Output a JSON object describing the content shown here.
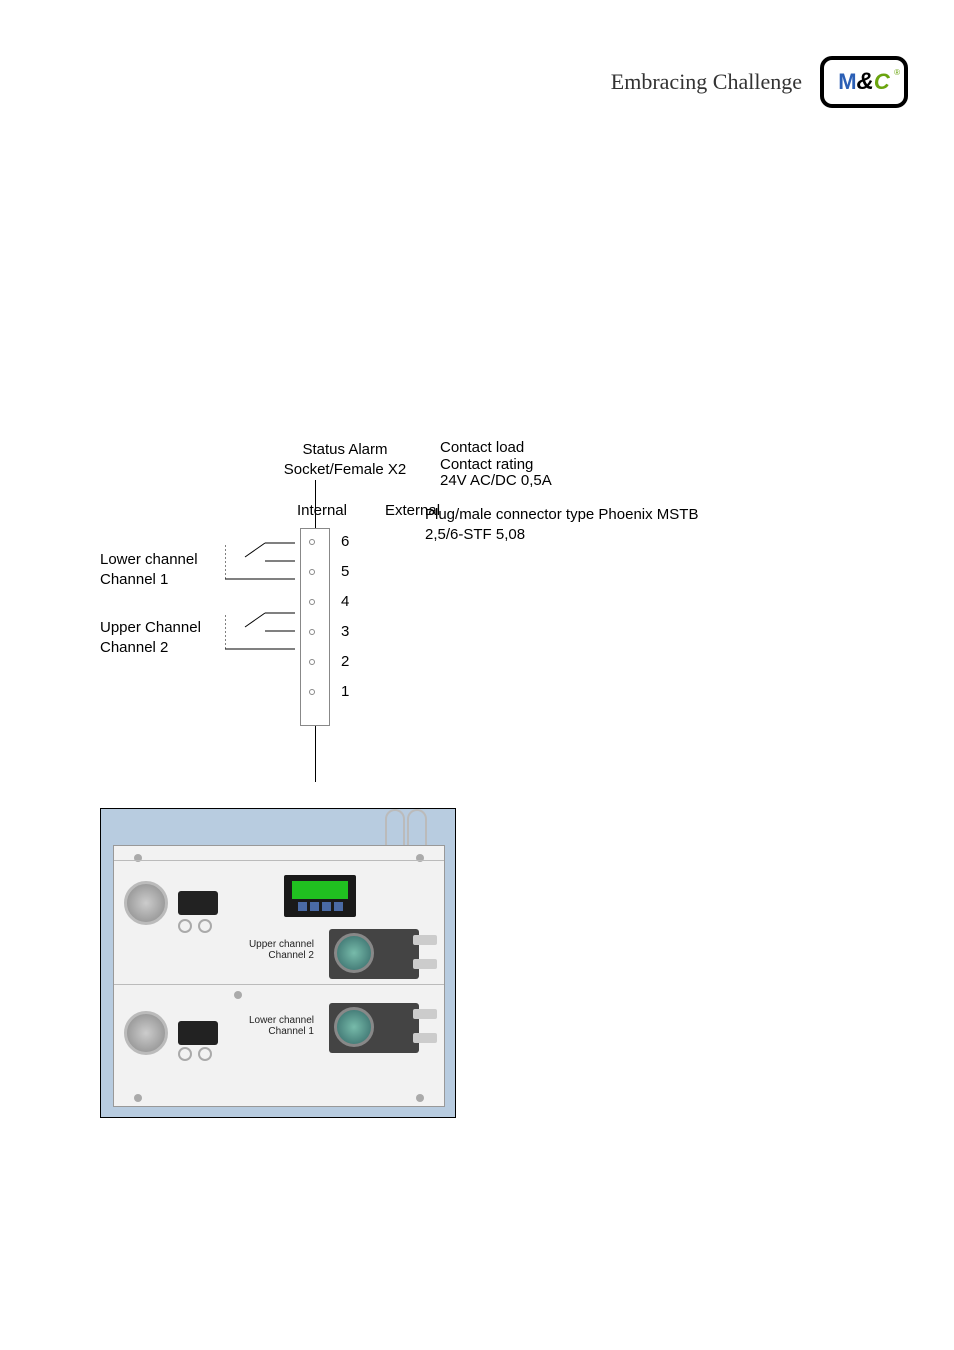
{
  "header": {
    "tagline": "Embracing Challenge",
    "logo_parts": {
      "m": "M",
      "amp": "&",
      "c": "C",
      "reg": "®"
    }
  },
  "diagram": {
    "socket_title_line1": "Status Alarm",
    "socket_title_line2": "Socket/Female X2",
    "contact_line1": "Contact load",
    "contact_line2": "Contact rating",
    "contact_line3": "24V AC/DC 0,5A",
    "internal_label": "Internal",
    "external_label": "External",
    "plug_line1": "Plug/male connector type Phoenix MSTB",
    "plug_line2": "2,5/6-STF 5,08",
    "lower_channel_line1": "Lower channel",
    "lower_channel_line2": "Channel 1",
    "upper_channel_line1": "Upper Channel",
    "upper_channel_line2": "Channel 2",
    "pins": [
      "6",
      "5",
      "4",
      "3",
      "2",
      "1"
    ]
  },
  "photo": {
    "upper_line1": "Upper channel",
    "upper_line2": "Channel 2",
    "lower_line1": "Lower channel",
    "lower_line2": "Channel 1"
  }
}
